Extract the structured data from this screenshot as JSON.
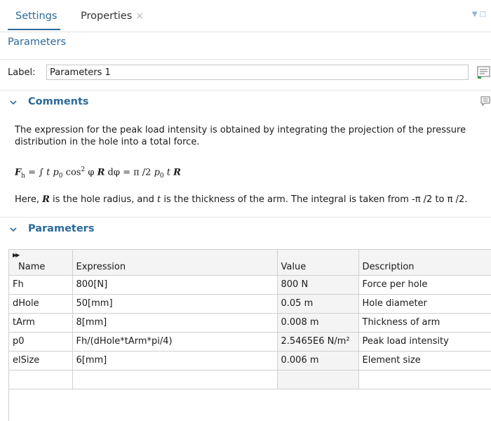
{
  "tabs": [
    {
      "label": "Settings",
      "active": true
    },
    {
      "label": "Properties",
      "active": false,
      "close": "×"
    }
  ],
  "section_title": "Parameters",
  "label_row": {
    "label": "Label:",
    "value": "Parameters 1"
  },
  "comments": {
    "header": "Comments",
    "paragraph1": "The expression for the peak load intensity is obtained by integrating the projection of the pressure distribution in the hole into a total force.",
    "formula": {
      "lhs_var": "F",
      "lhs_sub": "h",
      "eq1": " = ∫ ",
      "t": "t",
      "p": "p",
      "p_sub": "0",
      "cos": " cos",
      "cos_sup": "2",
      "phi": " φ ",
      "R": "R",
      "dphi": " dφ  = π /2 ",
      "p2": "p",
      "p2_sub": "0",
      "t2": " t ",
      "R2": "R"
    },
    "paragraph2": {
      "pre": "Here, ",
      "R": "R",
      "mid": " is the hole radius, and ",
      "t": "t",
      "post": " is the thickness of the arm. The integral is taken from -π /2 to π /2."
    }
  },
  "parameters": {
    "header": "Parameters",
    "columns": [
      "Name",
      "Expression",
      "Value",
      "Description"
    ],
    "rows": [
      {
        "name": "Fh",
        "expression": "800[N]",
        "value": "800 N",
        "description": "Force per hole"
      },
      {
        "name": "dHole",
        "expression": "50[mm]",
        "value": "0.05 m",
        "description": "Hole diameter"
      },
      {
        "name": "tArm",
        "expression": "8[mm]",
        "value": "0.008 m",
        "description": "Thickness of arm"
      },
      {
        "name": "p0",
        "expression": "Fh/(dHole*tArm*pi/4)",
        "value": "2.5465E6 N/m²",
        "description": "Peak load intensity"
      },
      {
        "name": "elSize",
        "expression": "6[mm]",
        "value": "0.006 m",
        "description": "Element size"
      }
    ]
  },
  "icons": {
    "chevron": "chevron-down-icon",
    "comment": "comment-icon",
    "label_button": "label-list-icon"
  },
  "colors": {
    "accent": "#2b6a99"
  }
}
